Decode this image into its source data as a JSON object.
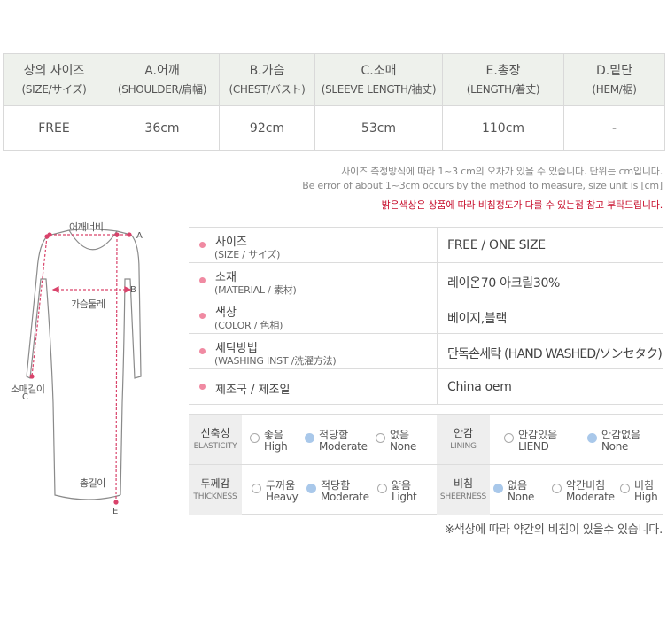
{
  "size_table": {
    "headers": [
      {
        "ko": "상의 사이즈",
        "sub": "(SIZE/サイズ)"
      },
      {
        "ko": "A.어깨",
        "sub": "(SHOULDER/肩幅)"
      },
      {
        "ko": "B.가슴",
        "sub": "(CHEST/バスト)"
      },
      {
        "ko": "C.소매",
        "sub": "(SLEEVE LENGTH/袖丈)"
      },
      {
        "ko": "E.총장",
        "sub": "(LENGTH/着丈)"
      },
      {
        "ko": "D.밑단",
        "sub": "(HEM/裾)"
      }
    ],
    "row": [
      "FREE",
      "36cm",
      "92cm",
      "53cm",
      "110cm",
      "-"
    ]
  },
  "notes": {
    "line1": "사이즈 측정방식에 따라 1~3 cm의 오차가 있을 수 있습니다.  단위는 cm입니다.",
    "line2": "Be error of about 1~3cm occurs by the method to measure, size unit is [cm]",
    "warning": "밝은색상은 상품에 따라 비침정도가 다를 수 있는점 참고 부탁드립니다."
  },
  "diagram": {
    "shoulder": "어깨너비",
    "chest": "가슴둘레",
    "sleeve": "소매길이",
    "length": "총길이",
    "letters": {
      "a": "A",
      "b": "B",
      "c": "C",
      "e": "E"
    }
  },
  "info": [
    {
      "label": "사이즈",
      "sub": "(SIZE / サイズ)",
      "value": "FREE / ONE SIZE"
    },
    {
      "label": "소재",
      "sub": "(MATERIAL / 素材)",
      "value": "레이온70 아크릴30%"
    },
    {
      "label": "색상",
      "sub": "(COLOR / 色相)",
      "value": "베이지,블랙"
    },
    {
      "label": "세탁방법",
      "sub": "(WASHING INST /洗濯方法)",
      "value": "단독손세탁 (HAND WASHED/ソンセタク)"
    },
    {
      "label": "제조국 / 제조일",
      "sub": "",
      "value": "China oem"
    }
  ],
  "attributes": {
    "elasticity": {
      "label": "신축성",
      "sub": "ELASTICITY",
      "options": [
        {
          "ko": "좋음",
          "en": "High"
        },
        {
          "ko": "적당함",
          "en": "Moderate"
        },
        {
          "ko": "없음",
          "en": "None"
        }
      ],
      "selected": 1
    },
    "lining": {
      "label": "안감",
      "sub": "LINING",
      "options": [
        {
          "ko": "안감있음",
          "en": "LIEND"
        },
        {
          "ko": "안감없음",
          "en": "None"
        }
      ],
      "selected": 1
    },
    "thickness": {
      "label": "두께감",
      "sub": "THICKNESS",
      "options": [
        {
          "ko": "두꺼움",
          "en": "Heavy"
        },
        {
          "ko": "적당함",
          "en": "Moderate"
        },
        {
          "ko": "얇음",
          "en": "Light"
        }
      ],
      "selected": 1
    },
    "sheerness": {
      "label": "비침",
      "sub": "SHEERNESS",
      "options": [
        {
          "ko": "없음",
          "en": "None"
        },
        {
          "ko": "약간비침",
          "en": "Moderate"
        },
        {
          "ko": "비침",
          "en": "High"
        }
      ],
      "selected": 0
    }
  },
  "footnote": "※색상에 따라 약간의 비침이 있을수 있습니다.",
  "colors": {
    "header_bg": "#eef1ec",
    "accent_dot": "#f08aa2",
    "radio_selected": "#a9c8ea",
    "warning": "#c8102e",
    "measure_line": "#d9436b"
  }
}
